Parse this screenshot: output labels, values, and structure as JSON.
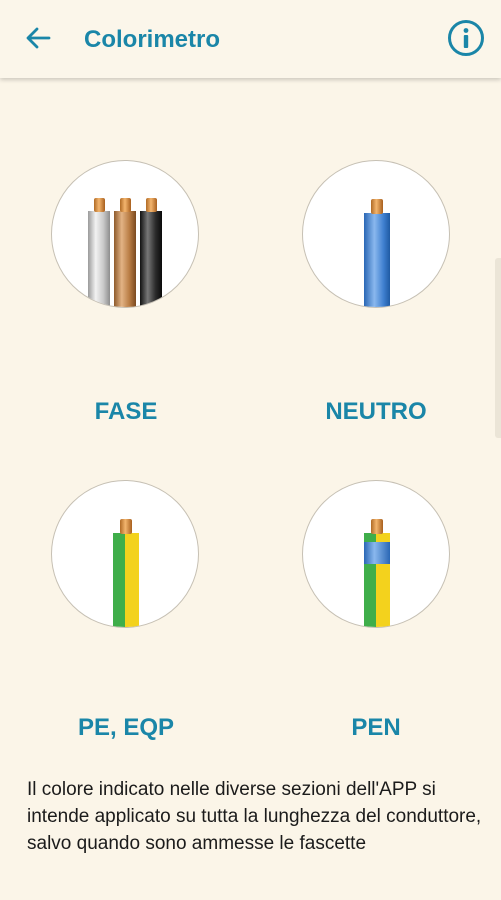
{
  "header": {
    "title": "Colorimetro",
    "back_icon": "arrow-left-icon",
    "info_icon": "info-circle-icon",
    "accent_color": "#1a86a8"
  },
  "categories": [
    {
      "label": "FASE",
      "icon": "three-phase-wires-gray-brown-black"
    },
    {
      "label": "NEUTRO",
      "icon": "blue-wire"
    },
    {
      "label": "PE, EQP",
      "icon": "green-yellow-wire"
    },
    {
      "label": "PEN",
      "icon": "green-yellow-wire-blue-sleeve"
    }
  ],
  "note": "Il colore indicato nelle diverse sezioni dell'APP si intende applicato su tutta la lunghezza del conduttore, salvo quando sono ammesse le fascette"
}
